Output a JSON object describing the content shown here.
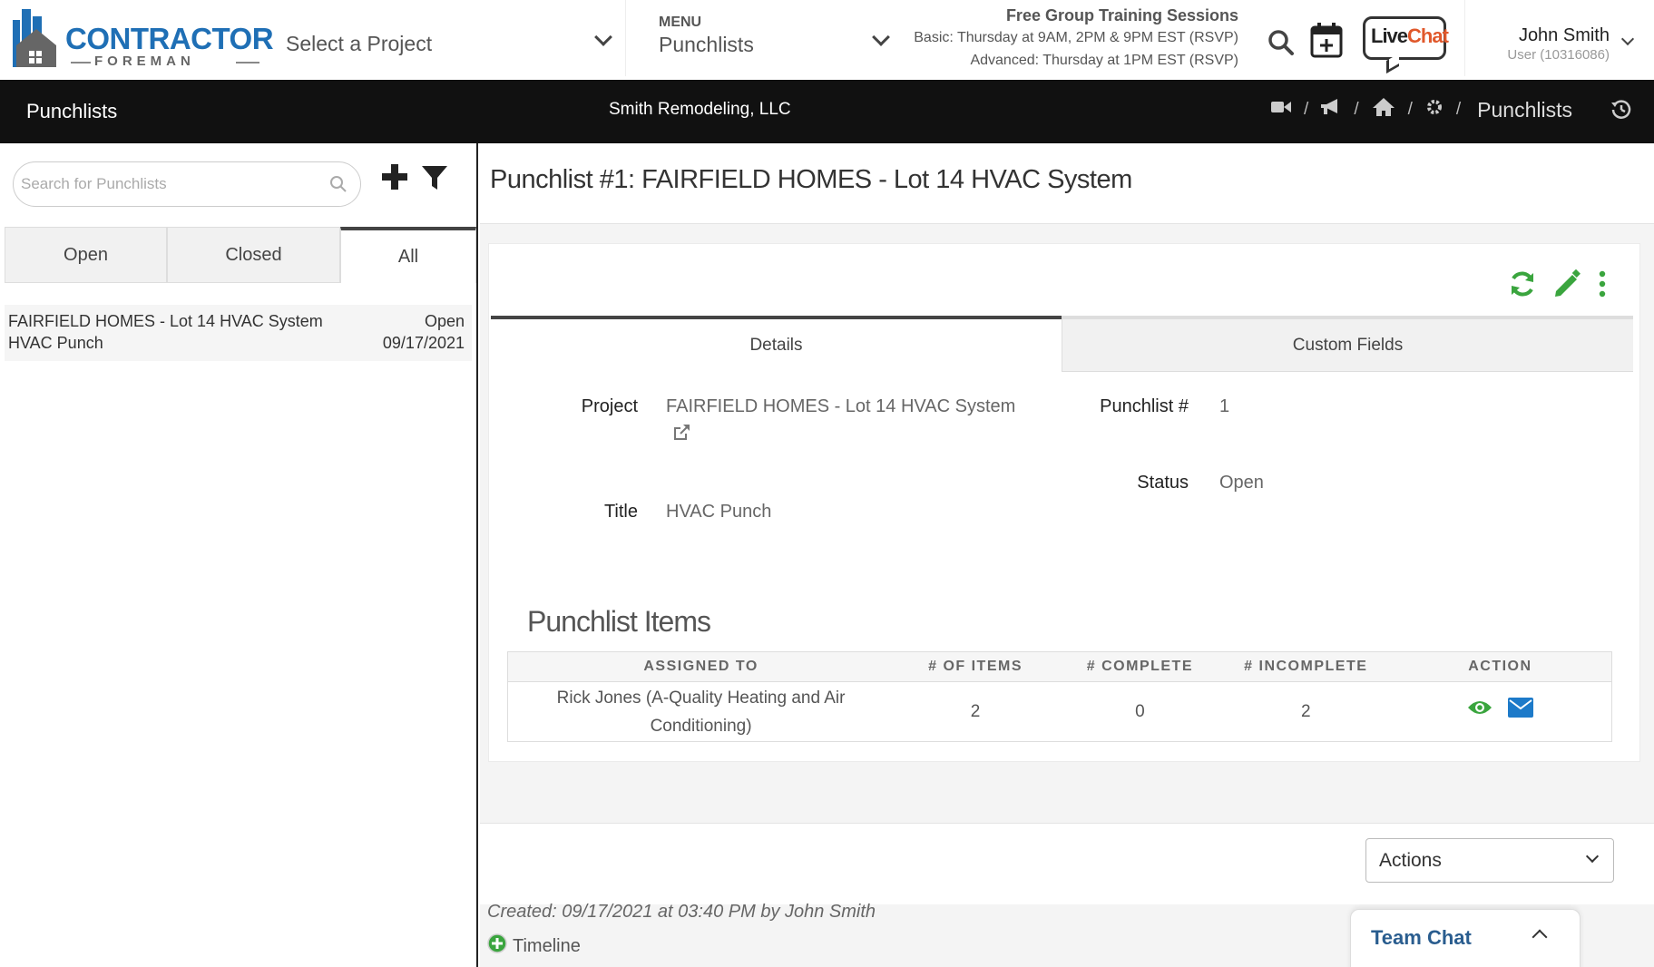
{
  "brand": {
    "logo_main": "CONTRACTOR",
    "logo_sub": "FOREMAN",
    "color_blue": "#1f6fb5"
  },
  "header": {
    "project_select": "Select a Project",
    "menu_small": "MENU",
    "menu_value": "Punchlists",
    "training_title": "Free Group Training Sessions",
    "training_basic": "Basic: Thursday at 9AM, 2PM & 9PM EST (RSVP)",
    "training_advanced": "Advanced: Thursday at 1PM EST (RSVP)",
    "livechat_live": "Live",
    "livechat_chat": "Chat",
    "user_name": "John Smith",
    "user_sub": "User (10316086)",
    "icons": [
      "search-icon",
      "calendar-plus-icon",
      "livechat-icon",
      "chevron-down-icon"
    ]
  },
  "blackbar": {
    "title": "Punchlists",
    "company": "Smith Remodeling, LLC",
    "breadcrumb_current": "Punchlists",
    "breadcrumb_icons": [
      "video-icon",
      "megaphone-icon",
      "home-icon",
      "gear-icon"
    ],
    "separator": "/"
  },
  "left": {
    "search_placeholder": "Search for Punchlists",
    "tabs": [
      "Open",
      "Closed",
      "All"
    ],
    "active_tab": "All",
    "items": [
      {
        "project": "FAIRFIELD HOMES - Lot 14 HVAC System",
        "title": "HVAC Punch",
        "status": "Open",
        "date": "09/17/2021"
      }
    ]
  },
  "detail": {
    "heading": "Punchlist #1: FAIRFIELD HOMES - Lot 14 HVAC System",
    "tabs": [
      "Details",
      "Custom Fields"
    ],
    "active_tab": "Details",
    "fields": {
      "project_label": "Project",
      "project_value": "FAIRFIELD HOMES - Lot 14 HVAC System",
      "title_label": "Title",
      "title_value": "HVAC Punch",
      "number_label": "Punchlist #",
      "number_value": "1",
      "status_label": "Status",
      "status_value": "Open"
    },
    "items_heading": "Punchlist Items",
    "table_headers": [
      "ASSIGNED TO",
      "# OF ITEMS",
      "# COMPLETE",
      "# INCOMPLETE",
      "ACTION"
    ],
    "table_rows": [
      {
        "assigned_to": "Rick Jones (A-Quality Heating and Air Conditioning)",
        "items": "2",
        "complete": "0",
        "incomplete": "2"
      }
    ],
    "actions_select": "Actions",
    "created": "Created: 09/17/2021 at 03:40 PM by John Smith",
    "timeline": "Timeline",
    "team_chat": "Team Chat",
    "accent_green": "#3aa53e",
    "accent_blue": "#1d7ac9"
  }
}
